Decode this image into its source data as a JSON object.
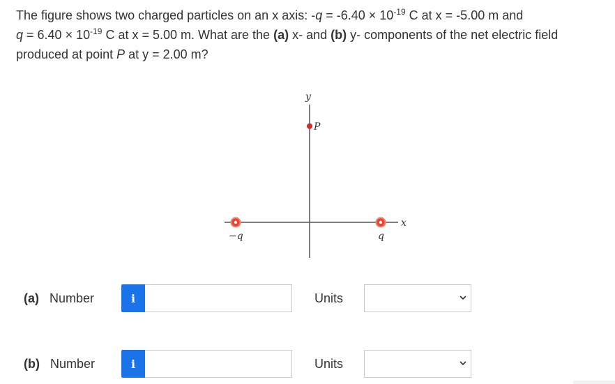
{
  "question": {
    "part1": "The figure shows two charged particles on an x axis: -",
    "q1": "q",
    "part2": " = -6.40 × 10",
    "exp1": "-19",
    "part3": " C at x = -5.00 m and",
    "q2": "q",
    "part4": " = 6.40 × 10",
    "exp2": "-19",
    "part5": " C at x = 5.00 m. What are the ",
    "a_label": "(a)",
    "part6": " x- and ",
    "b_label": "(b)",
    "part7": " y- components of the net electric field produced at point ",
    "p_label": "P",
    "part8": " at y = 2.00 m?"
  },
  "figure": {
    "y_axis_label": "y",
    "x_axis_label": "x",
    "point_label": "P",
    "left_charge_label": "−q",
    "right_charge_label": "q",
    "charge_color": "#e8432b",
    "point_color": "#d62b2b"
  },
  "answers": {
    "a": {
      "part": "(a)",
      "label": "Number",
      "info": "i",
      "units_label": "Units",
      "value": "",
      "units_value": ""
    },
    "b": {
      "part": "(b)",
      "label": "Number",
      "info": "i",
      "units_label": "Units",
      "value": "",
      "units_value": ""
    }
  },
  "colors": {
    "info_button": "#1a73e8",
    "text": "#333333",
    "border": "#c8c8c8"
  }
}
